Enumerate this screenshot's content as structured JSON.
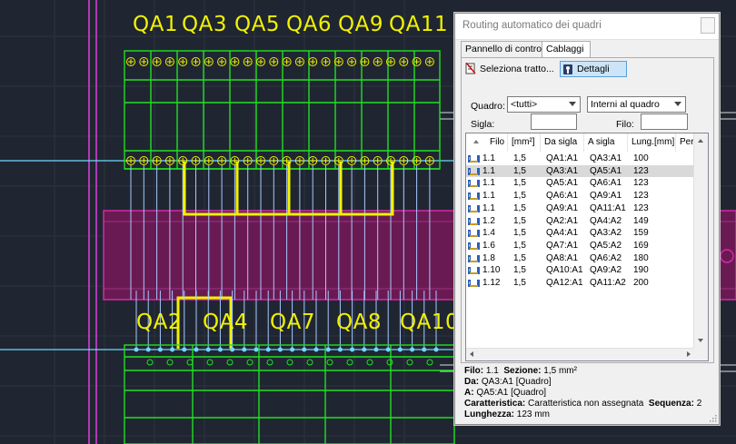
{
  "cad": {
    "top_labels": [
      "QA1",
      "QA3",
      "QA5",
      "QA6",
      "QA9",
      "QA11"
    ],
    "bottom_labels": [
      "QA2",
      "QA4",
      "QA7",
      "QA8",
      "QA10"
    ]
  },
  "dialog": {
    "title": "Routing automatico dei quadri",
    "tabs": [
      "Pannello di controllo",
      "Cablaggi"
    ],
    "active_tab": "Cablaggi",
    "toolbar": {
      "select_label": "Seleziona tratto...",
      "details_label": "Dettagli"
    },
    "filters": {
      "quadro_label": "Quadro:",
      "quadro_value": "<tutti>",
      "scope_value": "Interni al quadro",
      "sigla_label": "Sigla:",
      "filo_label": "Filo:"
    },
    "table": {
      "columns": [
        "Filo",
        "[mm²]",
        "Da sigla",
        "A sigla",
        "Lung.[mm]",
        "Percorso"
      ],
      "rows": [
        [
          "1.1",
          "1,5",
          "QA1:A1",
          "QA3:A1",
          "100"
        ],
        [
          "1.1",
          "1,5",
          "QA3:A1",
          "QA5:A1",
          "123"
        ],
        [
          "1.1",
          "1,5",
          "QA5:A1",
          "QA6:A1",
          "123"
        ],
        [
          "1.1",
          "1,5",
          "QA6:A1",
          "QA9:A1",
          "123"
        ],
        [
          "1.1",
          "1,5",
          "QA9:A1",
          "QA11:A1",
          "123"
        ],
        [
          "1.2",
          "1,5",
          "QA2:A1",
          "QA4:A2",
          "149"
        ],
        [
          "1.4",
          "1,5",
          "QA4:A1",
          "QA3:A2",
          "159"
        ],
        [
          "1.6",
          "1,5",
          "QA7:A1",
          "QA5:A2",
          "169"
        ],
        [
          "1.8",
          "1,5",
          "QA8:A1",
          "QA6:A2",
          "180"
        ],
        [
          "1.10",
          "1,5",
          "QA10:A1",
          "QA9:A2",
          "190"
        ],
        [
          "1.12",
          "1,5",
          "QA12:A1",
          "QA11:A2",
          "200"
        ]
      ],
      "selected_row": 1
    },
    "details": {
      "filo_label": "Filo:",
      "filo_value": "1.1",
      "sezione_label": "Sezione:",
      "sezione_value": "1,5 mm²",
      "da_label": "Da:",
      "da_value": "QA3:A1 [Quadro]",
      "a_label": "A:",
      "a_value": "QA5:A1 [Quadro]",
      "caratt_label": "Caratteristica:",
      "caratt_value": "Caratteristica non assegnata",
      "seq_label": "Sequenza:",
      "seq_value": "2",
      "lung_label": "Lunghezza:",
      "lung_value": "123 mm"
    }
  }
}
